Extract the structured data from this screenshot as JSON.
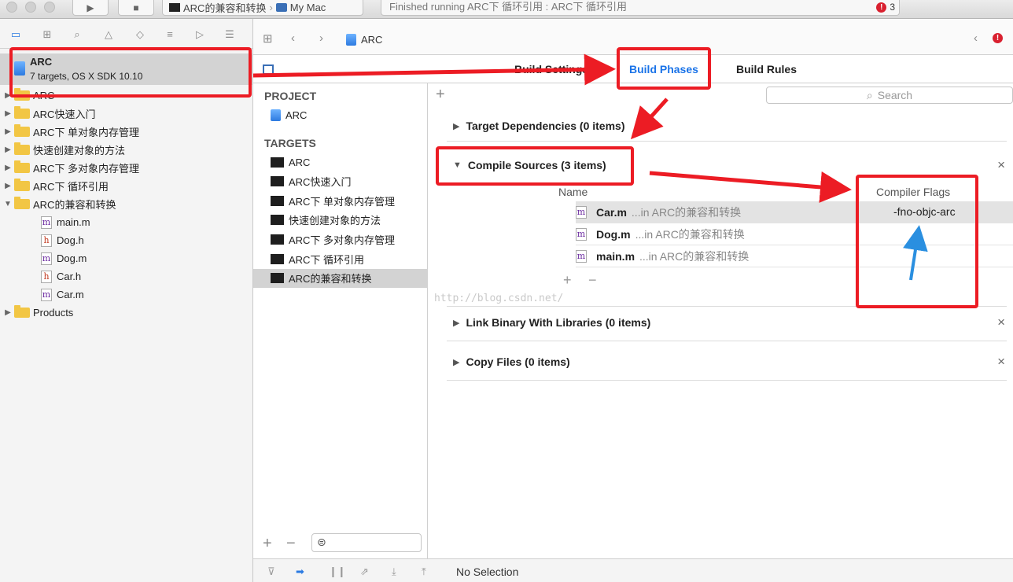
{
  "toolbar": {
    "scheme_target": "ARC的兼容和转换",
    "scheme_device": "My Mac",
    "activity_text": "Finished running ARC下 循环引用 : ARC下 循环引用",
    "error_count": "3"
  },
  "navigator": {
    "project_name": "ARC",
    "project_subtitle": "7 targets, OS X SDK 10.10",
    "tree": [
      {
        "label": "ARC",
        "kind": "folder",
        "expanded": false
      },
      {
        "label": "ARC快速入门",
        "kind": "folder",
        "expanded": false
      },
      {
        "label": "ARC下 单对象内存管理",
        "kind": "folder",
        "expanded": false
      },
      {
        "label": "快速创建对象的方法",
        "kind": "folder",
        "expanded": false
      },
      {
        "label": "ARC下 多对象内存管理",
        "kind": "folder",
        "expanded": false
      },
      {
        "label": "ARC下 循环引用",
        "kind": "folder",
        "expanded": false
      },
      {
        "label": "ARC的兼容和转换",
        "kind": "folder",
        "expanded": true
      },
      {
        "label": "main.m",
        "kind": "m"
      },
      {
        "label": "Dog.h",
        "kind": "h"
      },
      {
        "label": "Dog.m",
        "kind": "m"
      },
      {
        "label": "Car.h",
        "kind": "h"
      },
      {
        "label": "Car.m",
        "kind": "m"
      },
      {
        "label": "Products",
        "kind": "folder",
        "expanded": false
      }
    ]
  },
  "jumpbar": {
    "crumb": "ARC"
  },
  "tabs": {
    "build_settings": "Build Settings",
    "build_phases": "Build Phases",
    "build_rules": "Build Rules"
  },
  "targets_panel": {
    "project_header": "PROJECT",
    "project_item": "ARC",
    "targets_header": "TARGETS",
    "targets": [
      "ARC",
      "ARC快速入门",
      "ARC下 单对象内存管理",
      "快速创建对象的方法",
      "ARC下 多对象内存管理",
      "ARC下 循环引用",
      "ARC的兼容和转换"
    ],
    "selected_target": "ARC的兼容和转换"
  },
  "phases": {
    "search_placeholder": "Search",
    "target_dependencies": "Target Dependencies (0 items)",
    "compile_sources": "Compile Sources (3 items)",
    "col_name": "Name",
    "col_flags": "Compiler Flags",
    "sources": [
      {
        "file": "Car.m",
        "path": "...in ARC的兼容和转换",
        "flags": "-fno-objc-arc"
      },
      {
        "file": "Dog.m",
        "path": "...in ARC的兼容和转换",
        "flags": ""
      },
      {
        "file": "main.m",
        "path": "...in ARC的兼容和转换",
        "flags": ""
      }
    ],
    "link_binary": "Link Binary With Libraries (0 items)",
    "copy_files": "Copy Files (0 items)"
  },
  "watermark": "http://blog.csdn.net/",
  "status": {
    "selection": "No Selection"
  },
  "colors": {
    "accent": "#1a73e8",
    "annotation_red": "#ec1c24",
    "annotation_blue": "#2a8fe0"
  }
}
